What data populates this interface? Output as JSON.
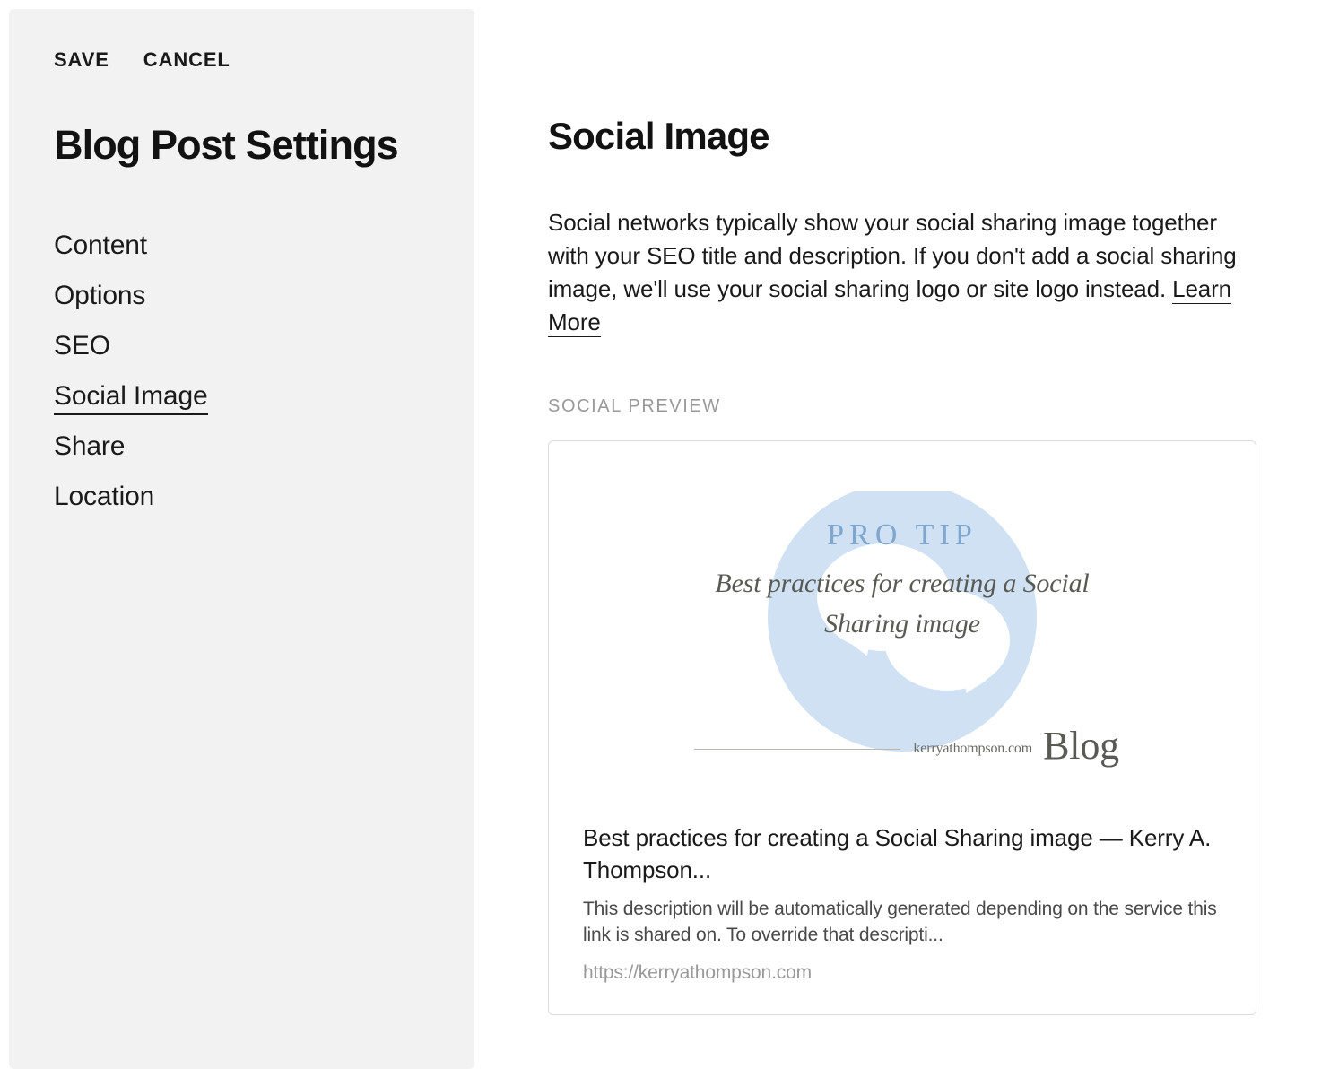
{
  "sidebar": {
    "actions": {
      "save": "SAVE",
      "cancel": "CANCEL"
    },
    "title": "Blog Post Settings",
    "nav": [
      {
        "label": "Content",
        "active": false
      },
      {
        "label": "Options",
        "active": false
      },
      {
        "label": "SEO",
        "active": false
      },
      {
        "label": "Social Image",
        "active": true
      },
      {
        "label": "Share",
        "active": false
      },
      {
        "label": "Location",
        "active": false
      }
    ]
  },
  "main": {
    "heading": "Social Image",
    "description": "Social networks typically show your social sharing image together with your SEO title and description. If you don't add a social sharing image, we'll use your social sharing logo or site logo instead. ",
    "learn_more": "Learn More",
    "section_label": "SOCIAL PREVIEW",
    "preview": {
      "image": {
        "badge": "PRO TIP",
        "line": "Best practices for creating a Social Sharing image",
        "footer_domain": "kerryathompson.com",
        "footer_word": "Blog"
      },
      "title": "Best practices for creating a Social Sharing image — Kerry A. Thompson...",
      "description": "This description will be automatically generated depending on the service this link is shared on. To override that descripti...",
      "url": "https://kerryathompson.com"
    }
  }
}
